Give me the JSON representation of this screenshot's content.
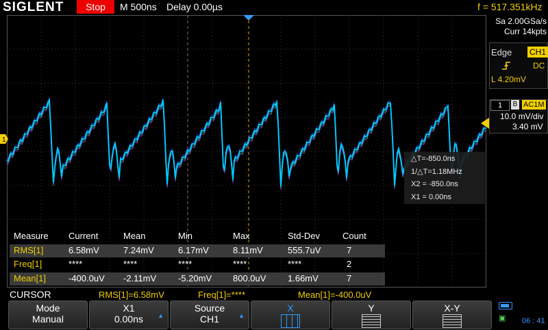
{
  "header": {
    "logo": "SIGLENT",
    "run_status": "Stop",
    "timebase": "M 500ns",
    "delay": "Delay 0.00µs",
    "frequency": "f = 517.351kHz"
  },
  "acquisition": {
    "sample_rate": "Sa 2.00GSa/s",
    "memory_depth": "Curr 14kpts"
  },
  "trigger": {
    "mode": "Edge",
    "source": "CH1",
    "coupling": "DC",
    "level": "L  4.20mV",
    "edge_icon": "rising-edge-icon"
  },
  "channel": {
    "number": "1",
    "bw_limit": "B",
    "coupling": "AC1M",
    "scale": "10.0 mV/div",
    "offset": "3.40 mV",
    "marker": "1"
  },
  "cursor_readout": {
    "delta_t": "△T=-850.0ns",
    "inv_delta_t": "1/△T=1.18MHz",
    "x2": "X2 = -850.0ns",
    "x1": "X1 = 0.00ns"
  },
  "measurements": {
    "headers": [
      "Measure",
      "Current",
      "Mean",
      "Min",
      "Max",
      "Std-Dev",
      "Count"
    ],
    "rows": [
      [
        "RMS[1]",
        "6.58mV",
        "7.24mV",
        "6.17mV",
        "8.11mV",
        "555.7uV",
        "7"
      ],
      [
        "Freq[1]",
        "****",
        "****",
        "****",
        "****",
        "****",
        "2"
      ],
      [
        "Mean[1]",
        "-400.0uV",
        "-2.11mV",
        "-5.20mV",
        "800.0uV",
        "1.66mV",
        "7"
      ]
    ]
  },
  "status_line": {
    "title": "CURSOR",
    "items": [
      "RMS[1]=6.58mV",
      "Freq[1]=****",
      "Mean[1]=-400.0uV"
    ]
  },
  "softkeys": [
    {
      "line1": "Mode",
      "line2": "Manual"
    },
    {
      "line1": "X1",
      "line2": "0.00ns"
    },
    {
      "line1": "Source",
      "line2": "CH1"
    },
    {
      "line1": "X"
    },
    {
      "line1": "Y"
    },
    {
      "line1": "X-Y"
    }
  ],
  "clock": "06 : 41",
  "colors": {
    "trace": "#00c8ff",
    "trigger": "#f0d000",
    "cursor": "#f0d000",
    "stop": "#ee0000"
  }
}
